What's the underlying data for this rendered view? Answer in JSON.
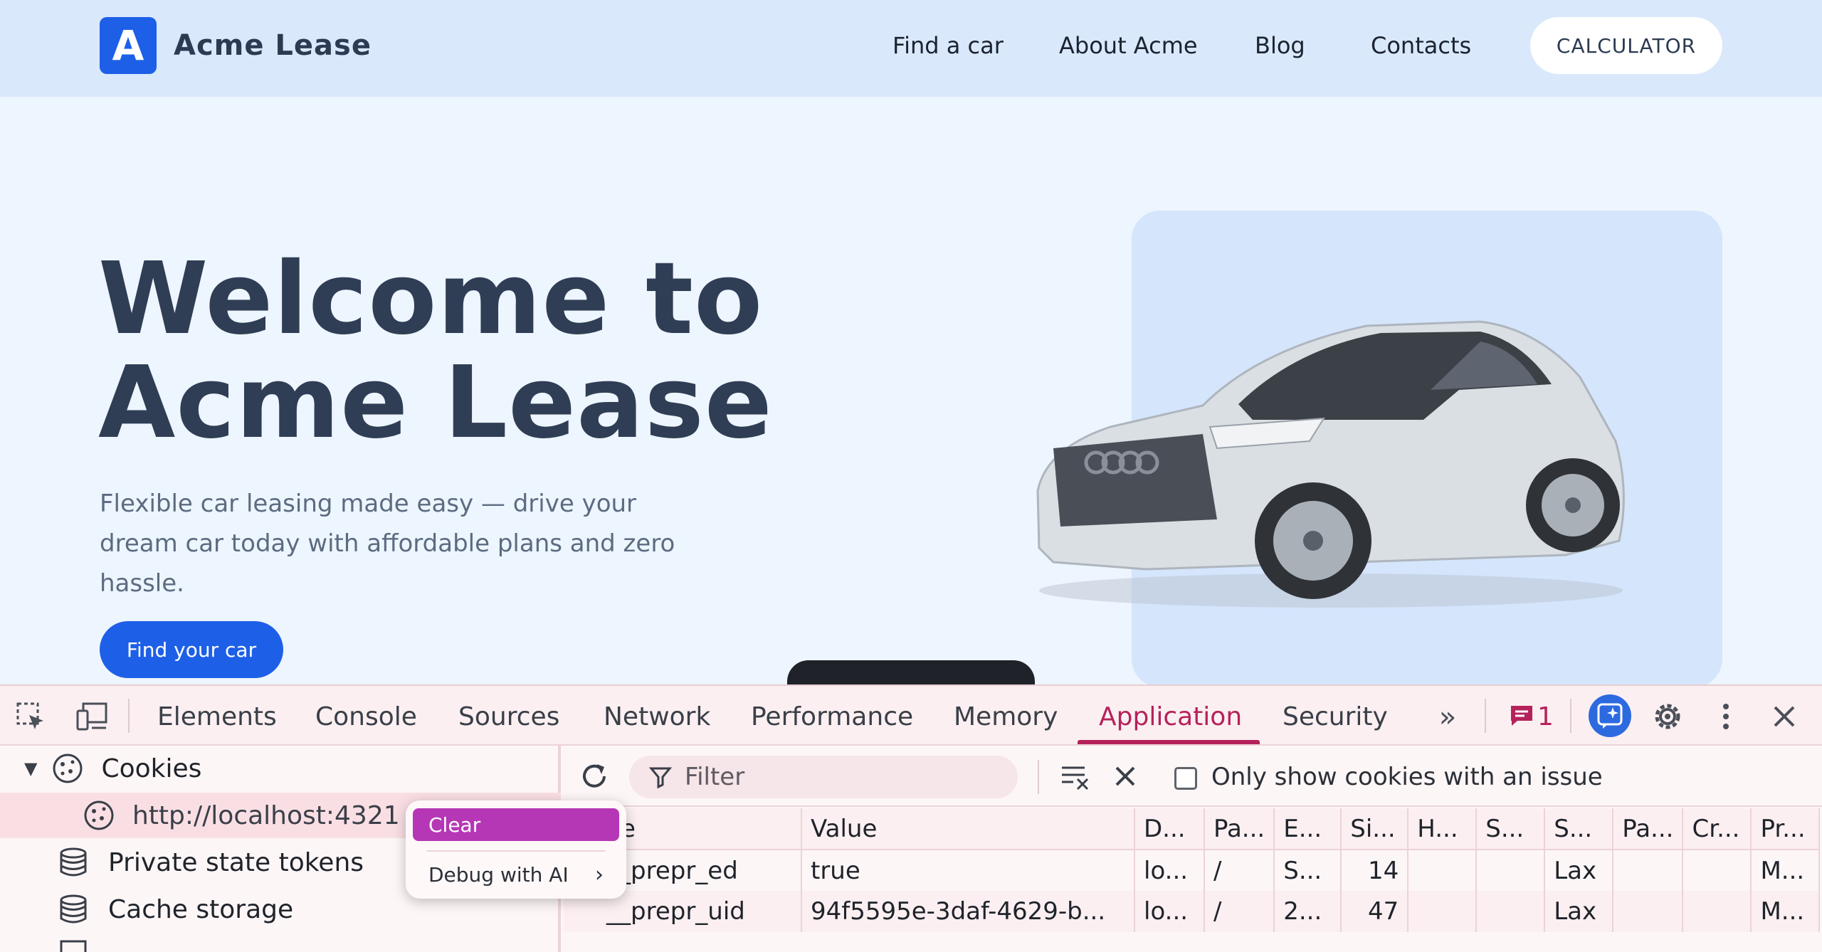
{
  "site": {
    "logo_letter": "A",
    "brand": "Acme Lease",
    "nav": [
      "Find a car",
      "About Acme",
      "Blog",
      "Contacts"
    ],
    "calculator_label": "CALCULATOR",
    "hero": {
      "title_line1": "Welcome to",
      "title_line2": "Acme Lease",
      "subtitle": "Flexible car leasing made easy — drive your dream car today with affordable plans and zero hassle.",
      "cta": "Find your car"
    }
  },
  "devtools": {
    "tabs": [
      "Elements",
      "Console",
      "Sources",
      "Network",
      "Performance",
      "Memory",
      "Application",
      "Security"
    ],
    "active_tab": "Application",
    "issues_count": "1",
    "sidebar": {
      "cookies": "Cookies",
      "cookie_origin": "http://localhost:4321",
      "private_state_tokens": "Private state tokens",
      "cache_storage": "Cache storage"
    },
    "filter_placeholder": "Filter",
    "only_issue_label": "Only show cookies with an issue",
    "table": {
      "headers": [
        "e",
        "Value",
        "D...",
        "Pa...",
        "E...",
        "Si...",
        "H...",
        "S...",
        "S...",
        "Pa...",
        "Cr...",
        "Pr..."
      ],
      "rows": [
        [
          "__prepr_ed",
          "true",
          "lo...",
          "/",
          "S...",
          "14",
          "",
          "",
          "Lax",
          "",
          "",
          "M..."
        ],
        [
          "__prepr_uid",
          "94f5595e-3daf-4629-b...",
          "lo...",
          "/",
          "2...",
          "47",
          "",
          "",
          "Lax",
          "",
          "",
          "M..."
        ]
      ]
    },
    "context_menu": {
      "clear": "Clear",
      "debug": "Debug with AI"
    }
  },
  "colors": {
    "brand_blue": "#1d5fe7",
    "active_tab": "#b5225b",
    "menu_highlight": "#b537b5"
  }
}
